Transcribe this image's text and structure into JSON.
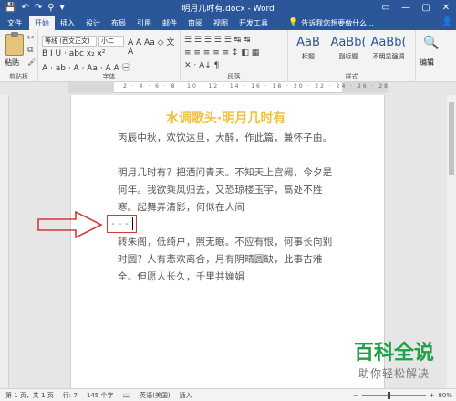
{
  "titlebar": {
    "qat": [
      "💾",
      "↶",
      "↷",
      "⚲",
      "▾"
    ],
    "title": "明月几时有.docx - Word",
    "window_buttons": [
      "▭",
      "—",
      "▢",
      "✕"
    ]
  },
  "tabs": [
    {
      "label": "文件"
    },
    {
      "label": "开始"
    },
    {
      "label": "插入"
    },
    {
      "label": "设计"
    },
    {
      "label": "布局"
    },
    {
      "label": "引用"
    },
    {
      "label": "邮件"
    },
    {
      "label": "审阅"
    },
    {
      "label": "视图"
    },
    {
      "label": "开发工具"
    }
  ],
  "tellme": "告诉我您想要做什么...",
  "ribbon": {
    "paste": "粘贴",
    "clipboard_label": "剪贴板",
    "font_name": "等线 (西文正文)",
    "font_size": "小二",
    "font_label": "字体",
    "font_row1": "A A Aa ◇ 文 A",
    "font_row2": "B I U · abc x₂ x²",
    "font_row3": "A · ab · A · Aa · A A ㊀",
    "para_row1": "☰ ☰ ☰ ☰ ☰ ↹ ↹",
    "para_row2": "≡ ≡ ≡ ≡ ≡ ↕ ◧ ▦",
    "para_row3": "✕ · A↓ ¶",
    "para_label": "段落",
    "styles": [
      {
        "sample": "AaB",
        "name": "标题"
      },
      {
        "sample": "AaBb(",
        "name": "副标题"
      },
      {
        "sample": "AaBb(",
        "name": "不明显强调"
      }
    ],
    "styles_label": "样式",
    "edit": "编辑"
  },
  "document": {
    "heading": "水调歌头·明月几时有",
    "para1": "丙辰中秋，欢饮达旦，大醉，作此篇，兼怀子由。",
    "para2": "明月几时有？把酒问青天。不知天上宫阙，今夕是何年。我欲乘风归去，又恐琼楼玉宇，高处不胜寒。起舞弄清影，何似在人间",
    "marker": "- - -",
    "para3": "转朱阁，低绮户，照无眠。不应有恨，何事长向别时圆？人有悲欢离合，月有阴晴圆缺，此事古难全。但愿人长久，千里共婵娟"
  },
  "status": {
    "page": "第 1 页，共 1 页",
    "row": "行: 7",
    "words": "145 个字",
    "lang": "英语(美国)",
    "insert": "插入",
    "zoom": "80%"
  },
  "watermark": {
    "main": "百科全说",
    "sub": "助你轻松解决"
  },
  "colors": {
    "brand": "#2b579a",
    "heading": "#f2bf39",
    "annotation": "#d03a3a",
    "watermark": "#1fa045"
  }
}
